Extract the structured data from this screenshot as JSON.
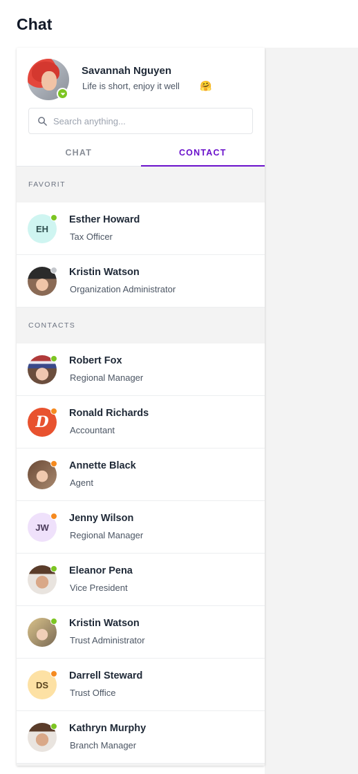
{
  "page": {
    "title": "Chat"
  },
  "profile": {
    "name": "Savannah Nguyen",
    "status_text": "Life is short, enjoy it well",
    "emoji": "🤗",
    "status_color": "#7cc522",
    "avatar_icon": "user-photo"
  },
  "search": {
    "placeholder": "Search anything..."
  },
  "tabs": [
    {
      "label": "CHAT",
      "active": false
    },
    {
      "label": "CONTACT",
      "active": true
    }
  ],
  "colors": {
    "accent": "#6a11cb",
    "online": "#7cc522",
    "away": "#f58a1f",
    "offline": "#c4c7cc",
    "section_bg": "#f3f3f3"
  },
  "sections": [
    {
      "title": "FAVORIT",
      "contacts": [
        {
          "name": "Esther Howard",
          "role": "Tax Officer",
          "avatar_type": "initials",
          "initials": "EH",
          "avatar_bg": "#cff5f1",
          "avatar_fg": "#2f4f4f",
          "status": "online"
        },
        {
          "name": "Kristin Watson",
          "role": "Organization Administrator",
          "avatar_type": "photo",
          "photo": "woman-black-hat",
          "status": "offline"
        }
      ]
    },
    {
      "title": "CONTACTS",
      "contacts": [
        {
          "name": "Robert Fox",
          "role": "Regional Manager",
          "avatar_type": "photo",
          "photo": "person-knit-cap",
          "status": "online"
        },
        {
          "name": "Ronald Richards",
          "role": "Accountant",
          "avatar_type": "logo",
          "logo_letter": "D",
          "avatar_bg": "#e8522f",
          "status": "away"
        },
        {
          "name": "Annette Black",
          "role": "Agent",
          "avatar_type": "photo",
          "photo": "woman-brown-hair",
          "status": "away"
        },
        {
          "name": "Jenny Wilson",
          "role": "Regional Manager",
          "avatar_type": "initials",
          "initials": "JW",
          "avatar_bg": "#efe1fb",
          "avatar_fg": "#4a3a5a",
          "status": "away"
        },
        {
          "name": "Eleanor Pena",
          "role": "Vice President",
          "avatar_type": "photo",
          "photo": "man-short-hair",
          "status": "online"
        },
        {
          "name": "Kristin Watson",
          "role": "Trust Administrator",
          "avatar_type": "photo",
          "photo": "woman-blonde-hair",
          "status": "online"
        },
        {
          "name": "Darrell Steward",
          "role": "Trust Office",
          "avatar_type": "initials",
          "initials": "DS",
          "avatar_bg": "#fde1a4",
          "avatar_fg": "#5a4520",
          "status": "away"
        },
        {
          "name": "Kathryn Murphy",
          "role": "Branch Manager",
          "avatar_type": "photo",
          "photo": "man-short-hair",
          "status": "online"
        }
      ]
    }
  ]
}
